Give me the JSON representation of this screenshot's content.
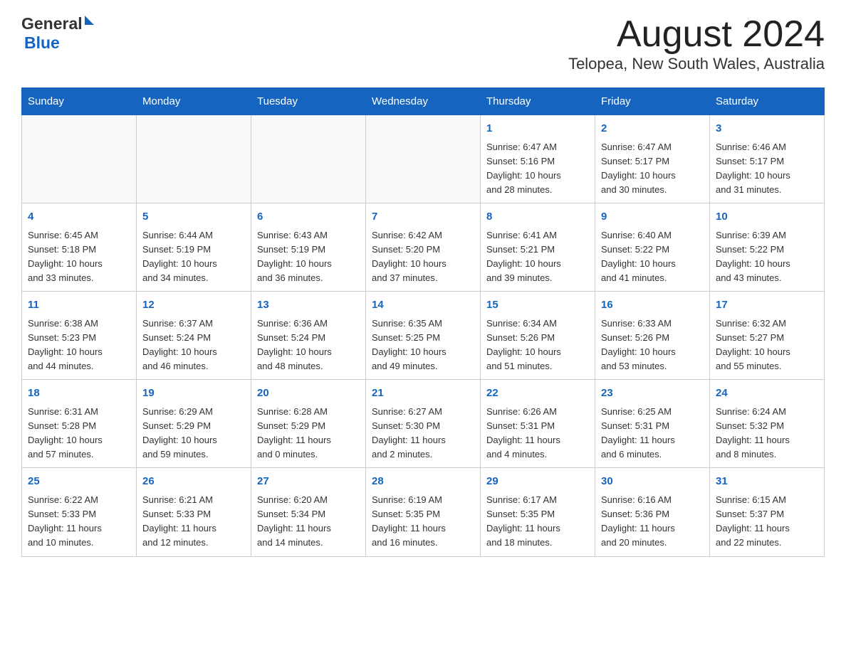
{
  "header": {
    "logo_general": "General",
    "logo_blue": "Blue",
    "month_title": "August 2024",
    "location": "Telopea, New South Wales, Australia"
  },
  "days_of_week": [
    "Sunday",
    "Monday",
    "Tuesday",
    "Wednesday",
    "Thursday",
    "Friday",
    "Saturday"
  ],
  "weeks": [
    [
      {
        "day": "",
        "info": ""
      },
      {
        "day": "",
        "info": ""
      },
      {
        "day": "",
        "info": ""
      },
      {
        "day": "",
        "info": ""
      },
      {
        "day": "1",
        "info": "Sunrise: 6:47 AM\nSunset: 5:16 PM\nDaylight: 10 hours\nand 28 minutes."
      },
      {
        "day": "2",
        "info": "Sunrise: 6:47 AM\nSunset: 5:17 PM\nDaylight: 10 hours\nand 30 minutes."
      },
      {
        "day": "3",
        "info": "Sunrise: 6:46 AM\nSunset: 5:17 PM\nDaylight: 10 hours\nand 31 minutes."
      }
    ],
    [
      {
        "day": "4",
        "info": "Sunrise: 6:45 AM\nSunset: 5:18 PM\nDaylight: 10 hours\nand 33 minutes."
      },
      {
        "day": "5",
        "info": "Sunrise: 6:44 AM\nSunset: 5:19 PM\nDaylight: 10 hours\nand 34 minutes."
      },
      {
        "day": "6",
        "info": "Sunrise: 6:43 AM\nSunset: 5:19 PM\nDaylight: 10 hours\nand 36 minutes."
      },
      {
        "day": "7",
        "info": "Sunrise: 6:42 AM\nSunset: 5:20 PM\nDaylight: 10 hours\nand 37 minutes."
      },
      {
        "day": "8",
        "info": "Sunrise: 6:41 AM\nSunset: 5:21 PM\nDaylight: 10 hours\nand 39 minutes."
      },
      {
        "day": "9",
        "info": "Sunrise: 6:40 AM\nSunset: 5:22 PM\nDaylight: 10 hours\nand 41 minutes."
      },
      {
        "day": "10",
        "info": "Sunrise: 6:39 AM\nSunset: 5:22 PM\nDaylight: 10 hours\nand 43 minutes."
      }
    ],
    [
      {
        "day": "11",
        "info": "Sunrise: 6:38 AM\nSunset: 5:23 PM\nDaylight: 10 hours\nand 44 minutes."
      },
      {
        "day": "12",
        "info": "Sunrise: 6:37 AM\nSunset: 5:24 PM\nDaylight: 10 hours\nand 46 minutes."
      },
      {
        "day": "13",
        "info": "Sunrise: 6:36 AM\nSunset: 5:24 PM\nDaylight: 10 hours\nand 48 minutes."
      },
      {
        "day": "14",
        "info": "Sunrise: 6:35 AM\nSunset: 5:25 PM\nDaylight: 10 hours\nand 49 minutes."
      },
      {
        "day": "15",
        "info": "Sunrise: 6:34 AM\nSunset: 5:26 PM\nDaylight: 10 hours\nand 51 minutes."
      },
      {
        "day": "16",
        "info": "Sunrise: 6:33 AM\nSunset: 5:26 PM\nDaylight: 10 hours\nand 53 minutes."
      },
      {
        "day": "17",
        "info": "Sunrise: 6:32 AM\nSunset: 5:27 PM\nDaylight: 10 hours\nand 55 minutes."
      }
    ],
    [
      {
        "day": "18",
        "info": "Sunrise: 6:31 AM\nSunset: 5:28 PM\nDaylight: 10 hours\nand 57 minutes."
      },
      {
        "day": "19",
        "info": "Sunrise: 6:29 AM\nSunset: 5:29 PM\nDaylight: 10 hours\nand 59 minutes."
      },
      {
        "day": "20",
        "info": "Sunrise: 6:28 AM\nSunset: 5:29 PM\nDaylight: 11 hours\nand 0 minutes."
      },
      {
        "day": "21",
        "info": "Sunrise: 6:27 AM\nSunset: 5:30 PM\nDaylight: 11 hours\nand 2 minutes."
      },
      {
        "day": "22",
        "info": "Sunrise: 6:26 AM\nSunset: 5:31 PM\nDaylight: 11 hours\nand 4 minutes."
      },
      {
        "day": "23",
        "info": "Sunrise: 6:25 AM\nSunset: 5:31 PM\nDaylight: 11 hours\nand 6 minutes."
      },
      {
        "day": "24",
        "info": "Sunrise: 6:24 AM\nSunset: 5:32 PM\nDaylight: 11 hours\nand 8 minutes."
      }
    ],
    [
      {
        "day": "25",
        "info": "Sunrise: 6:22 AM\nSunset: 5:33 PM\nDaylight: 11 hours\nand 10 minutes."
      },
      {
        "day": "26",
        "info": "Sunrise: 6:21 AM\nSunset: 5:33 PM\nDaylight: 11 hours\nand 12 minutes."
      },
      {
        "day": "27",
        "info": "Sunrise: 6:20 AM\nSunset: 5:34 PM\nDaylight: 11 hours\nand 14 minutes."
      },
      {
        "day": "28",
        "info": "Sunrise: 6:19 AM\nSunset: 5:35 PM\nDaylight: 11 hours\nand 16 minutes."
      },
      {
        "day": "29",
        "info": "Sunrise: 6:17 AM\nSunset: 5:35 PM\nDaylight: 11 hours\nand 18 minutes."
      },
      {
        "day": "30",
        "info": "Sunrise: 6:16 AM\nSunset: 5:36 PM\nDaylight: 11 hours\nand 20 minutes."
      },
      {
        "day": "31",
        "info": "Sunrise: 6:15 AM\nSunset: 5:37 PM\nDaylight: 11 hours\nand 22 minutes."
      }
    ]
  ]
}
